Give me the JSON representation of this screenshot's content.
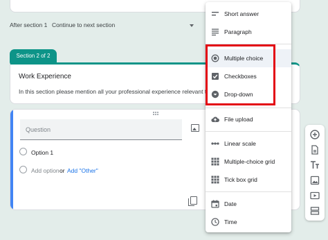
{
  "after_section": {
    "label": "After section 1",
    "value": "Continue to next section"
  },
  "section": {
    "tab_label": "Section 2 of 2",
    "title": "Work Experience",
    "description": "In this section please mention all your professional experience relevant to th"
  },
  "question": {
    "placeholder": "Question",
    "options": [
      "Option 1"
    ],
    "add_option": "Add option",
    "or_label": "or",
    "add_other": "Add \"Other\""
  },
  "type_menu": {
    "items": [
      {
        "label": "Short answer",
        "icon": "short-text-icon"
      },
      {
        "label": "Paragraph",
        "icon": "paragraph-icon"
      },
      {
        "label": "Multiple choice",
        "icon": "radio-button-icon",
        "selected": true
      },
      {
        "label": "Checkboxes",
        "icon": "checkbox-icon"
      },
      {
        "label": "Drop-down",
        "icon": "dropdown-circle-icon"
      },
      {
        "label": "File upload",
        "icon": "cloud-upload-icon"
      },
      {
        "label": "Linear scale",
        "icon": "linear-scale-icon"
      },
      {
        "label": "Multiple-choice grid",
        "icon": "grid-icon"
      },
      {
        "label": "Tick box grid",
        "icon": "grid-icon"
      },
      {
        "label": "Date",
        "icon": "calendar-icon"
      },
      {
        "label": "Time",
        "icon": "clock-icon"
      }
    ]
  },
  "side_toolbar": {
    "buttons": [
      "add-question-icon",
      "import-questions-icon",
      "add-title-icon",
      "add-image-icon",
      "add-video-icon",
      "add-section-icon"
    ]
  },
  "colors": {
    "accent": "#0d9488",
    "question_accent": "#4285f4",
    "highlight": "#e30613",
    "link": "#1a73e8"
  }
}
